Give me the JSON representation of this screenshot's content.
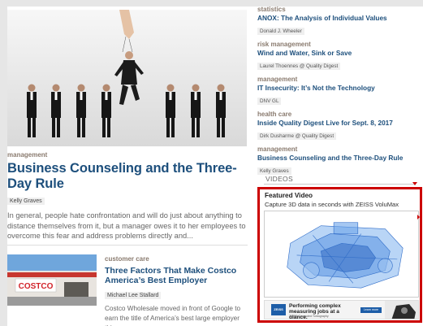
{
  "hero": {
    "category": "management",
    "title": "Business Counseling and the Three-Day Rule",
    "author": "Kelly Graves",
    "excerpt": "In general, people hate confrontation and will do just about anything to distance themselves from it, but a manager owes it to her employees to overcome this fear and address problems directly and..."
  },
  "story2": {
    "category": "customer care",
    "title": "Three Factors That Make Costco America’s Best Employer",
    "author": "Michael Lee Stallard",
    "excerpt": "Costco Wholesale moved in front of Google to earn the title of America’s best large employer this",
    "sign_text": "COSTCO"
  },
  "sidebar": {
    "items": [
      {
        "category": "statistics",
        "title": "ANOX: The Analysis of Individual Values",
        "author": "Donald J. Wheeler"
      },
      {
        "category": "risk management",
        "title": "Wind and Water, Sink or Save",
        "author": "Laurel Thoennes @ Quality Digest"
      },
      {
        "category": "management",
        "title": "IT Insecurity: It’s Not the Technology",
        "author": "DNV GL"
      },
      {
        "category": "health care",
        "title": "Inside Quality Digest Live for Sept. 8, 2017",
        "author": "Dirk Dusharme @ Quality Digest"
      },
      {
        "category": "management",
        "title": "Business Counseling and the Three-Day Rule",
        "author": "Kelly Graves"
      }
    ],
    "videos_label": "VIDEOS"
  },
  "featured": {
    "title": "Featured Video",
    "subtitle": "Capture 3D data in seconds with ZEISS VoluMax"
  },
  "ad": {
    "logo": "ZEISS",
    "headline": "Performing complex measuring jobs at a glance.",
    "small_text": "ZEISS Computed Tomography",
    "button": "Learn more"
  },
  "colors": {
    "link": "#1d4f7c",
    "category": "#8a7b6f",
    "highlight_border": "#cc0000"
  }
}
